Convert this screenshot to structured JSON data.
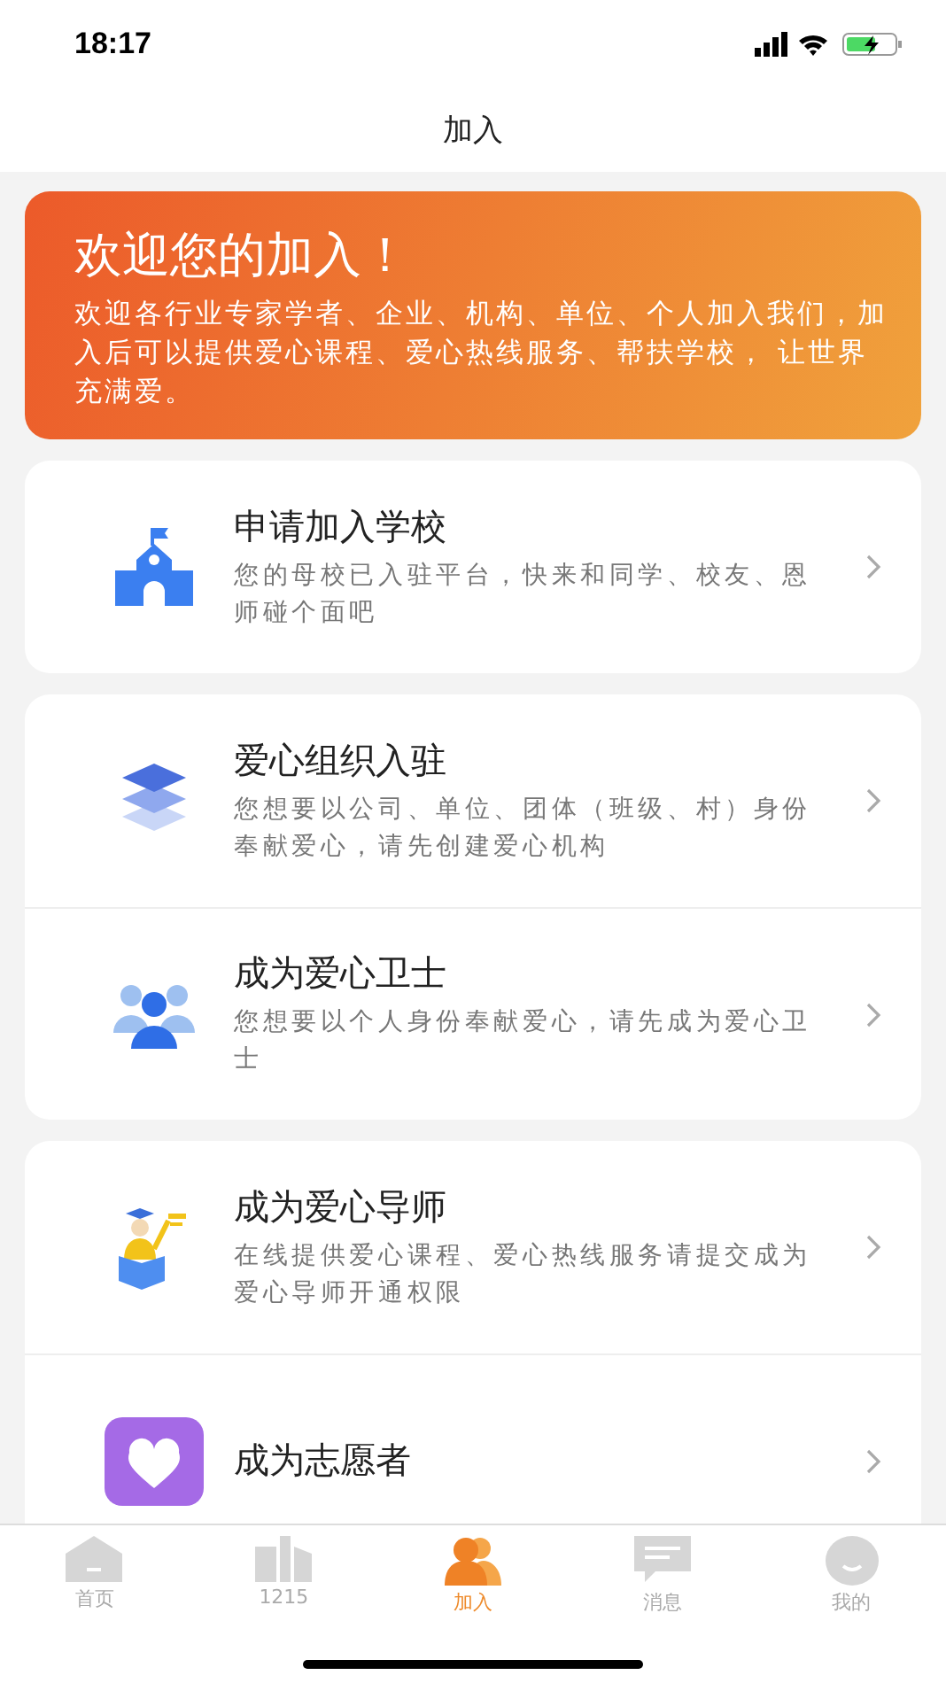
{
  "status_bar": {
    "time": "18:17"
  },
  "nav": {
    "title": "加入"
  },
  "banner": {
    "title": "欢迎您的加入！",
    "text": "欢迎各行业专家学者、企业、机构、单位、个人加入我们，加入后可以提供爱心课程、爱心热线服务、帮扶学校， 让世界充满爱。"
  },
  "cards": [
    {
      "items": [
        {
          "kind": "school",
          "title": "申请加入学校",
          "description": "您的母校已入驻平台，快来和同学、校友、恩师碰个面吧"
        }
      ]
    },
    {
      "items": [
        {
          "kind": "layers",
          "title": "爱心组织入驻",
          "description": "您想要以公司、单位、团体（班级、村）身份奉献爱心，请先创建爱心机构"
        },
        {
          "kind": "people",
          "title": "成为爱心卫士",
          "description": "您想要以个人身份奉献爱心，请先成为爱心卫士"
        }
      ]
    },
    {
      "items": [
        {
          "kind": "tutor",
          "title": "成为爱心导师",
          "description": "在线提供爱心课程、爱心热线服务请提交成为爱心导师开通权限"
        },
        {
          "kind": "volunteer",
          "title": "成为志愿者"
        }
      ]
    }
  ],
  "tabs": [
    {
      "kind": "home",
      "label": "首页",
      "selected": false
    },
    {
      "kind": "city",
      "label": "1215",
      "selected": false
    },
    {
      "kind": "join",
      "label": "加入",
      "selected": true
    },
    {
      "kind": "message",
      "label": "消息",
      "selected": false
    },
    {
      "kind": "me",
      "label": "我的",
      "selected": false
    }
  ]
}
